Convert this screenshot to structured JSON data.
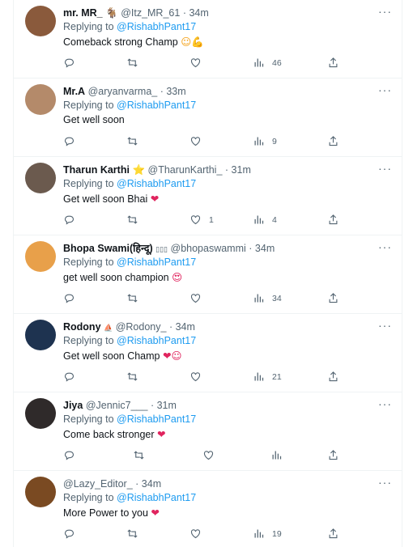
{
  "tweets": [
    {
      "name": "mr. MR_",
      "badge": "🐐",
      "handle": "@Itz_MR_61",
      "time": "34m",
      "reply_prefix": "Replying to",
      "mention": "@RishabhPant17",
      "text": "Comeback strong Champ",
      "emoji": "☺💪",
      "likes": "",
      "views": "46",
      "avatar_color": "#8a5a3c"
    },
    {
      "name": "Mr.A",
      "badge": "",
      "handle": "@aryanvarma_",
      "time": "33m",
      "reply_prefix": "Replying to",
      "mention": "@RishabhPant17",
      "text": "Get well soon",
      "emoji": "",
      "likes": "",
      "views": "9",
      "avatar_color": "#b48a6a"
    },
    {
      "name": "Tharun Karthi",
      "badge": "⭐",
      "handle": "@TharunKarthi_",
      "time": "31m",
      "reply_prefix": "Replying to",
      "mention": "@RishabhPant17",
      "text": "Get well soon Bhai",
      "emoji": "❤",
      "likes": "1",
      "views": "4",
      "avatar_color": "#6b5a4e"
    },
    {
      "name": "Bhopa Swami(हिन्दू)",
      "badge": "▯▯▯",
      "handle": "@bhopaswammi",
      "time": "34m",
      "reply_prefix": "Replying to",
      "mention": "@RishabhPant17",
      "text": "get well soon champion",
      "emoji": "😍",
      "likes": "",
      "views": "34",
      "avatar_color": "#e8a04a"
    },
    {
      "name": "Rodony",
      "badge": "⛵",
      "handle": "@Rodony_",
      "time": "34m",
      "reply_prefix": "Replying to",
      "mention": "@RishabhPant17",
      "text": "Get well soon Champ",
      "emoji": "❤☺",
      "likes": "",
      "views": "21",
      "avatar_color": "#1e3350"
    },
    {
      "name": "Jiya",
      "badge": "",
      "handle": "@Jennic7___",
      "time": "31m",
      "reply_prefix": "Replying to",
      "mention": "@RishabhPant17",
      "text": "Come back stronger",
      "emoji": "❤",
      "likes": "",
      "views": "",
      "avatar_color": "#2f2a2a"
    },
    {
      "name": "",
      "badge": "",
      "handle": "@Lazy_Editor_",
      "time": "34m",
      "reply_prefix": "Replying to",
      "mention": "@RishabhPant17",
      "text": "More Power to you",
      "emoji": "❤",
      "likes": "",
      "views": "19",
      "avatar_color": "#7a4a22"
    }
  ],
  "dot": "·",
  "more_label": "···"
}
